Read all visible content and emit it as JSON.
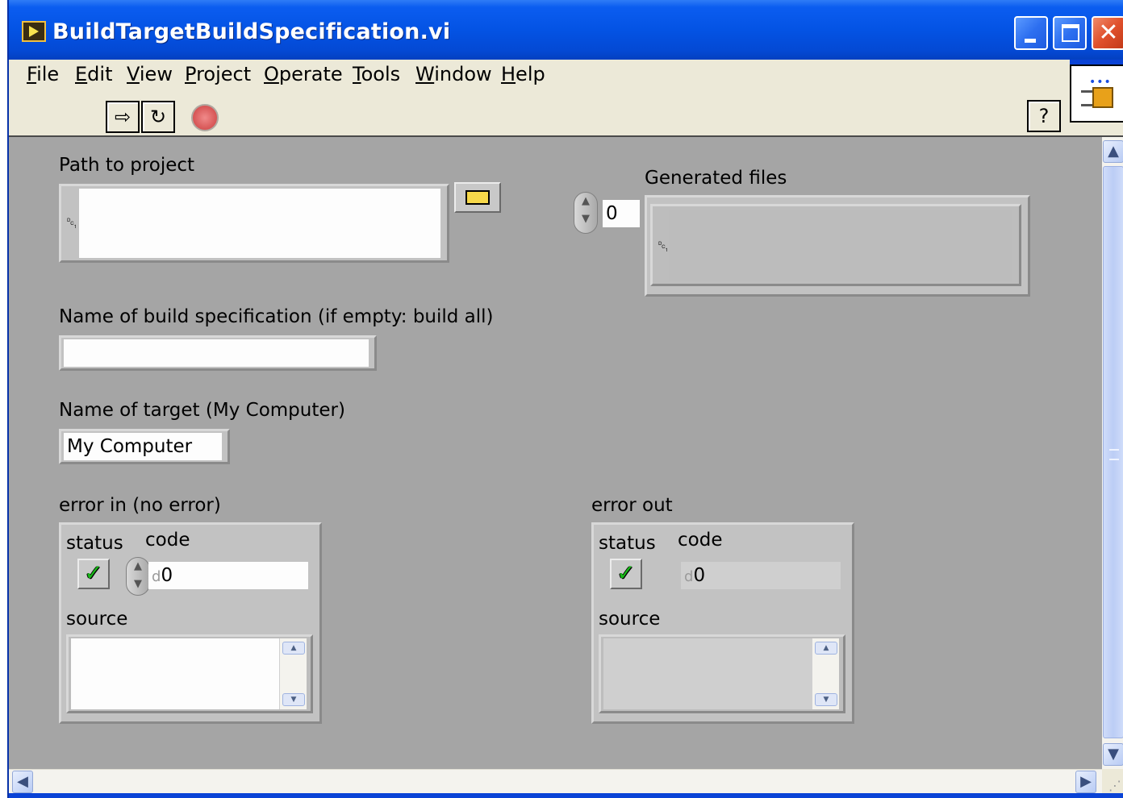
{
  "window": {
    "title": "BuildTargetBuildSpecification.vi",
    "controls": {
      "minimize": "minimize",
      "maximize": "maximize",
      "close": "✕"
    }
  },
  "menu": {
    "items": [
      {
        "label": "File",
        "accel": "F",
        "rest": "ile"
      },
      {
        "label": "Edit",
        "accel": "E",
        "rest": "dit"
      },
      {
        "label": "View",
        "accel": "V",
        "rest": "iew"
      },
      {
        "label": "Project",
        "accel": "P",
        "rest": "roject"
      },
      {
        "label": "Operate",
        "accel": "O",
        "rest": "perate"
      },
      {
        "label": "Tools",
        "accel": "T",
        "rest": "ools"
      },
      {
        "label": "Window",
        "accel": "W",
        "rest": "indow"
      },
      {
        "label": "Help",
        "accel": "H",
        "rest": "elp"
      }
    ]
  },
  "toolbar": {
    "run_icon": "run-arrow-icon",
    "run_glyph": "⇨",
    "run_continuous_icon": "run-continuously-icon",
    "run_continuous_glyph": "↻",
    "abort_icon": "abort-stop-icon",
    "help_glyph": "?"
  },
  "panel": {
    "path_to_project": {
      "label": "Path to project",
      "value": "",
      "path_glyph": "␑"
    },
    "generated_files": {
      "label": "Generated files",
      "index": "0",
      "path_glyph": "␑"
    },
    "build_spec": {
      "label": "Name of build specification (if empty: build all)",
      "value": ""
    },
    "target": {
      "label": "Name of target (My Computer)",
      "value": "My Computer"
    },
    "error_in": {
      "label": "error in (no error)",
      "status_label": "status",
      "code_label": "code",
      "code_prefix": "d",
      "code_value": "0",
      "source_label": "source",
      "source_value": "",
      "status_glyph": "✓"
    },
    "error_out": {
      "label": "error out",
      "status_label": "status",
      "code_label": "code",
      "code_prefix": "d",
      "code_value": "0",
      "source_label": "source",
      "source_value": "",
      "status_glyph": "✓"
    }
  },
  "scrollbars": {
    "up": "▲",
    "down": "▼",
    "left": "◀",
    "right": "▶"
  },
  "colors": {
    "titlebar": "#0453e4",
    "panel_bg": "#a5a5a5",
    "chrome": "#ece9d8",
    "status_ok": "#18b818"
  }
}
